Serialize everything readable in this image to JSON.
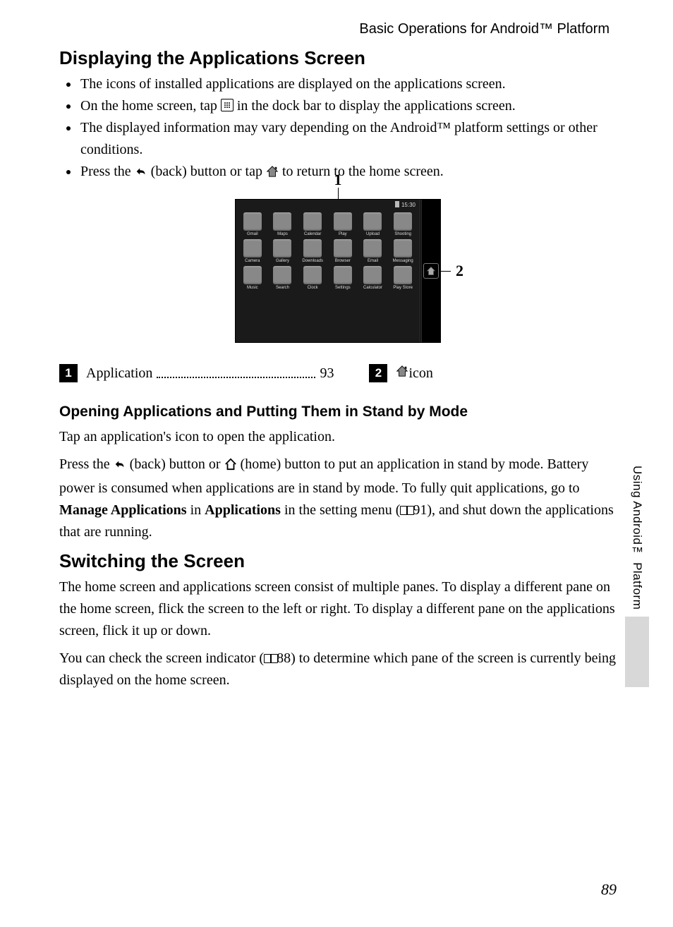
{
  "running_head": "Basic Operations for Android™ Platform",
  "h2_1": "Displaying the Applications Screen",
  "bullets": {
    "b1": "The icons of installed applications are displayed on the applications screen.",
    "b2a": "On the home screen, tap ",
    "b2b": " in the dock bar to display the applications screen.",
    "b3": "The displayed information may vary depending on the Android™ platform settings or other conditions.",
    "b4a": "Press the ",
    "b4b": " (back) button or tap ",
    "b4c": " to return to the home screen."
  },
  "figure": {
    "callout1": "1",
    "callout2": "2",
    "statusTime": "15:30",
    "apps": [
      "Gmail",
      "Maps",
      "Calendar",
      "Play",
      "Upload",
      "Shooting",
      "Camera",
      "Gallery",
      "Downloads",
      "Browser",
      "Email",
      "Messaging",
      "Music",
      "Search",
      "Clock",
      "Settings",
      "Calculator",
      "Play Store"
    ]
  },
  "legend": {
    "n1": "1",
    "l1": "Application",
    "p1": "93",
    "n2": "2",
    "l2": " icon"
  },
  "h3_1": "Opening Applications and Putting Them in Stand by Mode",
  "para1": "Tap an application's icon to open the application.",
  "para2a": "Press the ",
  "para2b": " (back) button or ",
  "para2c": " (home) button to put an application in stand by mode. Battery power is consumed when applications are in stand by mode. To fully quit applications, go to ",
  "para2_bold1": "Manage Applications",
  "para2d": " in ",
  "para2_bold2": "Applications",
  "para2e": " in the setting menu (",
  "para2_ref": "91",
  "para2f": "), and shut down the applications that are running.",
  "h2_2": "Switching the Screen",
  "para3": "The home screen and applications screen consist of multiple panes. To display a different pane on the home screen, flick the screen to the left or right. To display a different pane on the applications screen, flick it up or down.",
  "para4a": "You can check the screen indicator (",
  "para4_ref": "88",
  "para4b": ") to determine which pane of the screen is currently being displayed on the home screen.",
  "side_tab": "Using Android™ Platform",
  "page_no": "89"
}
